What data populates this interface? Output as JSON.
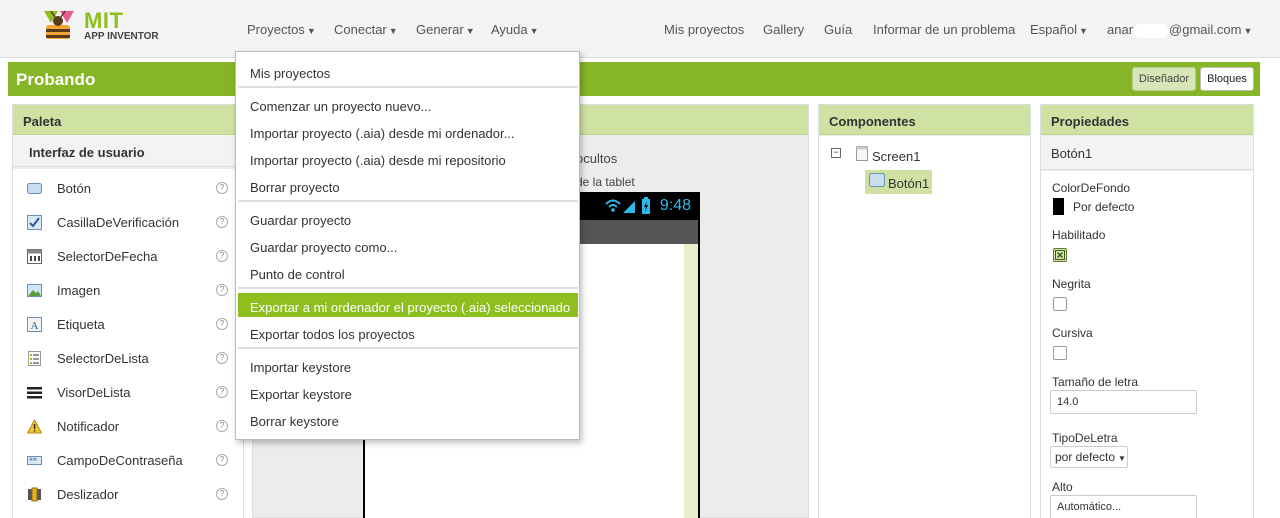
{
  "header": {
    "logo_mit": "MIT",
    "logo_sub": "APP INVENTOR",
    "nav_left": [
      "Proyectos",
      "Conectar",
      "Generar",
      "Ayuda"
    ],
    "nav_right": [
      "Mis proyectos",
      "Gallery",
      "Guía",
      "Informar de un problema",
      "Español"
    ],
    "account_prefix": "anar",
    "account_suffix": "@gmail.com"
  },
  "project": {
    "title": "Probando",
    "designer_label": "Diseñador",
    "blocks_label": "Bloques"
  },
  "palette": {
    "title": "Paleta",
    "category": "Interfaz de usuario",
    "help_glyph": "?",
    "items": [
      {
        "label": "Botón",
        "icon": "button-icon"
      },
      {
        "label": "CasillaDeVerificación",
        "icon": "checkbox-icon"
      },
      {
        "label": "SelectorDeFecha",
        "icon": "calendar-icon"
      },
      {
        "label": "Imagen",
        "icon": "image-icon"
      },
      {
        "label": "Etiqueta",
        "icon": "label-icon"
      },
      {
        "label": "SelectorDeLista",
        "icon": "list-picker-icon"
      },
      {
        "label": "VisorDeLista",
        "icon": "list-view-icon"
      },
      {
        "label": "Notificador",
        "icon": "warning-icon"
      },
      {
        "label": "CampoDeContraseña",
        "icon": "password-icon"
      },
      {
        "label": "Deslizador",
        "icon": "slider-icon"
      }
    ]
  },
  "viewer": {
    "hidden_text": "ocultos",
    "tablet_text": "de la tablet",
    "phone_time": "9:48"
  },
  "components": {
    "title": "Componentes",
    "toggle_glyph": "⊟",
    "tree": [
      {
        "label": "Screen1"
      },
      {
        "label": "Botón1"
      }
    ]
  },
  "properties": {
    "title": "Propiedades",
    "component": "Botón1",
    "bg_color_label": "ColorDeFondo",
    "bg_color_value": "Por defecto",
    "enabled_label": "Habilitado",
    "bold_label": "Negrita",
    "italic_label": "Cursiva",
    "font_size_label": "Tamaño de letra",
    "font_size_value": "14.0",
    "font_type_label": "TipoDeLetra",
    "font_type_value": "por defecto",
    "height_label": "Alto",
    "height_value": "Automático..."
  },
  "menu": {
    "items": [
      "Mis proyectos",
      "Comenzar un proyecto nuevo...",
      "Importar proyecto (.aia) desde mi ordenador...",
      "Importar proyecto (.aia) desde mi repositorio",
      "Borrar proyecto",
      "Guardar proyecto",
      "Guardar proyecto como...",
      "Punto de control",
      "Exportar a mi ordenador el proyecto (.aia) seleccionado",
      "Exportar todos los proyectos",
      "Importar keystore",
      "Exportar keystore",
      "Borrar keystore"
    ],
    "highlighted": "Exportar a mi ordenador el proyecto (.aia) seleccionado"
  },
  "colors": {
    "accent_green": "#86b527",
    "highlight_green": "#8fbf1f",
    "panel_header": "#cfe2a4"
  }
}
